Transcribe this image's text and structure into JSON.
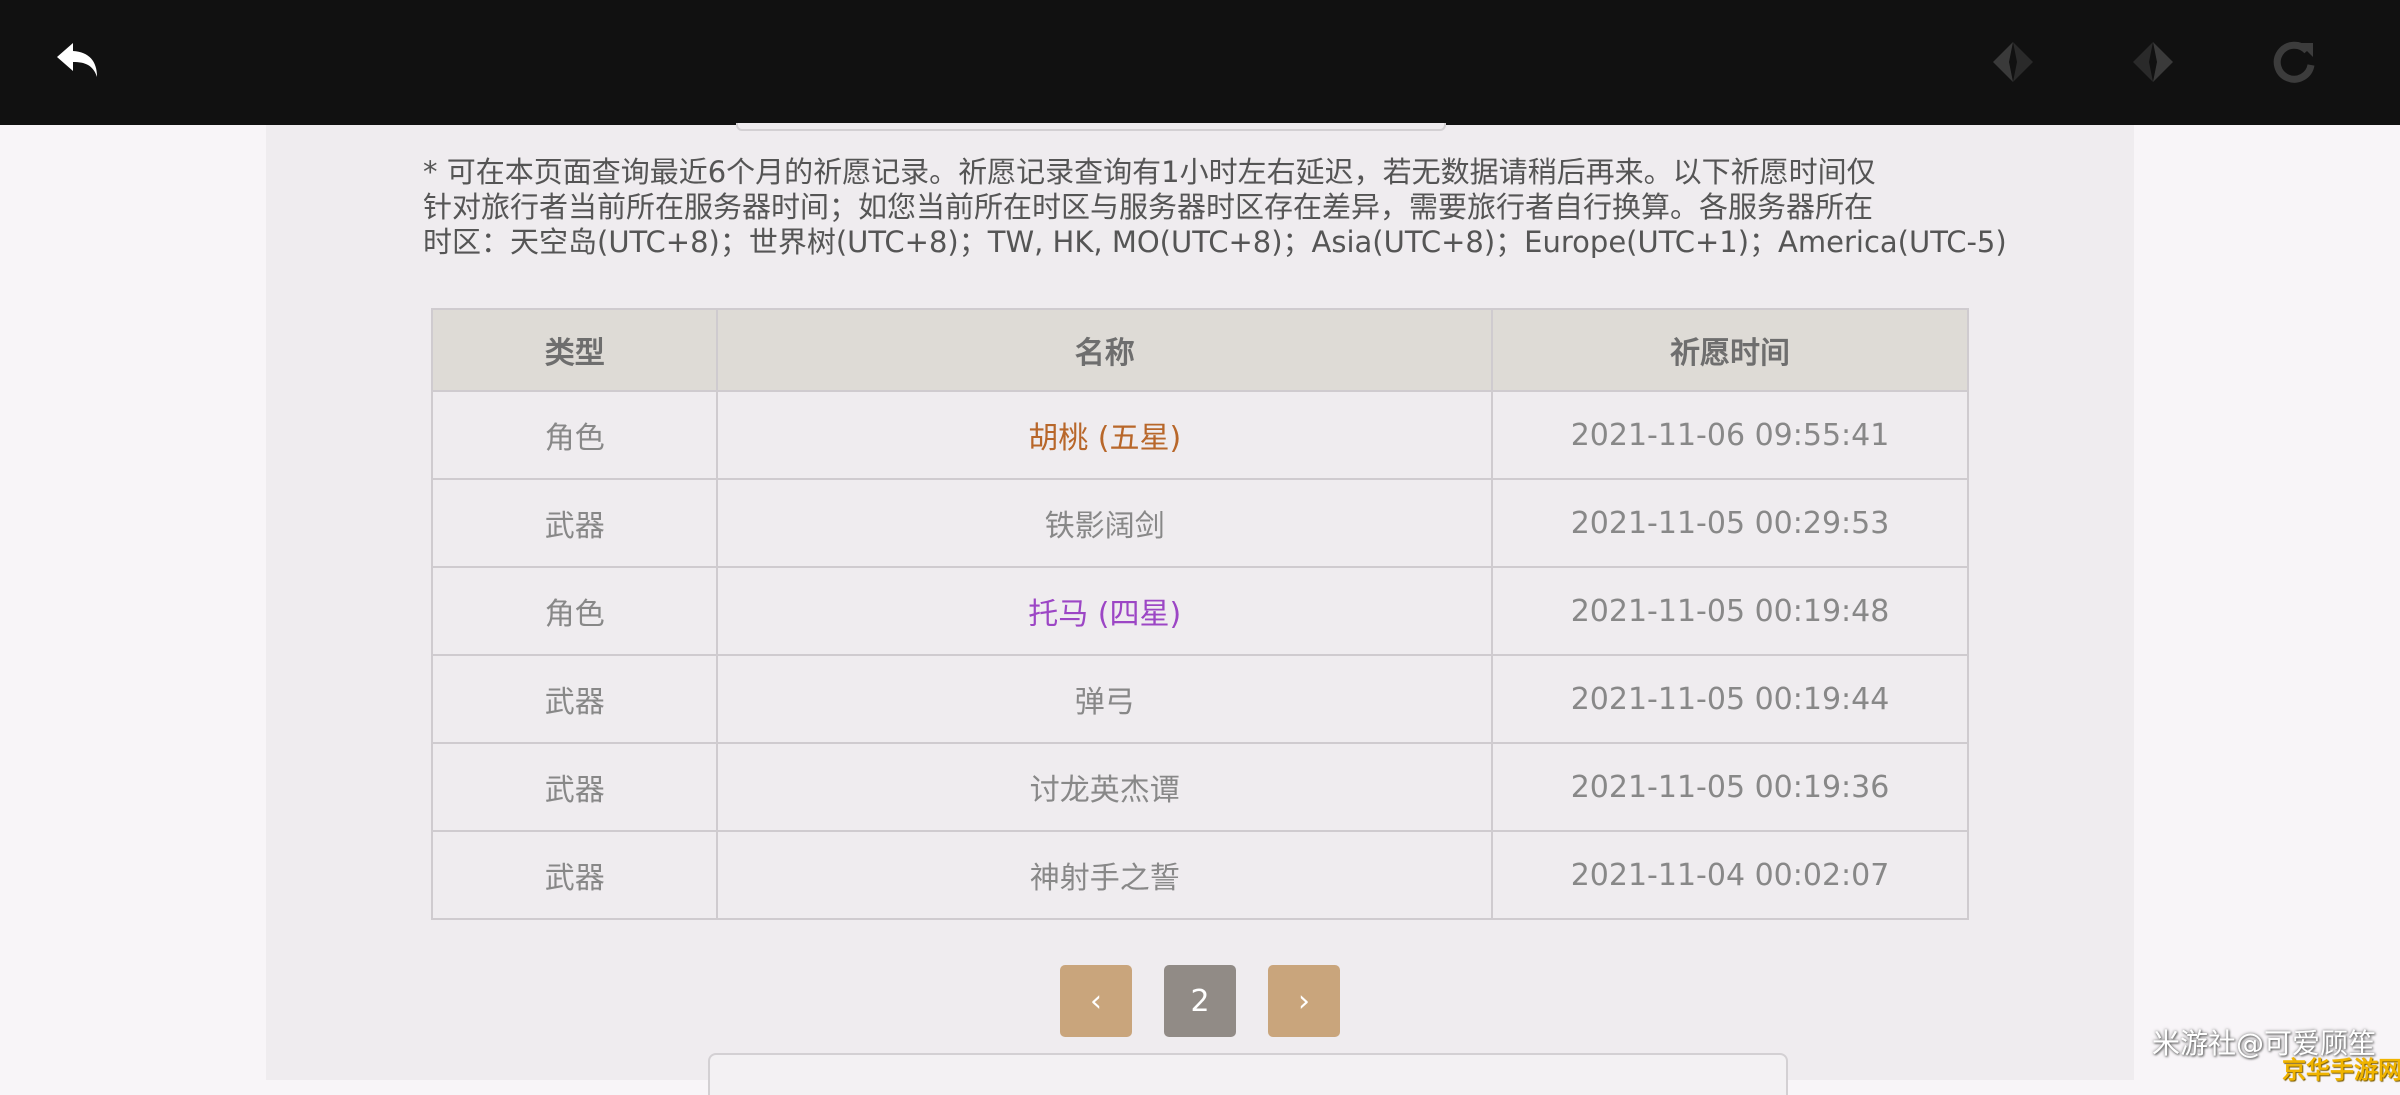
{
  "toolbar": {
    "back_icon": "back-arrow-icon",
    "prev_icon": "diamond-left-icon",
    "next_icon": "diamond-right-icon",
    "refresh_icon": "refresh-icon"
  },
  "notice": {
    "line1": "* 可在本页面查询最近6个月的祈愿记录。祈愿记录查询有1小时左右延迟，若无数据请稍后再来。以下祈愿时间仅",
    "line2": "针对旅行者当前所在服务器时间；如您当前所在时区与服务器时区存在差异，需要旅行者自行换算。各服务器所在",
    "line3": "时区：天空岛(UTC+8)；世界树(UTC+8)；TW, HK, MO(UTC+8)；Asia(UTC+8)；Europe(UTC+1)；America(UTC-5)"
  },
  "table": {
    "headers": [
      "类型",
      "名称",
      "祈愿时间"
    ],
    "rows": [
      {
        "type": "角色",
        "name": "胡桃 (五星)",
        "time": "2021-11-06 09:55:41",
        "rarity_color": "#b8672a"
      },
      {
        "type": "武器",
        "name": "铁影阔剑",
        "time": "2021-11-05 00:29:53",
        "rarity_color": "#888888"
      },
      {
        "type": "角色",
        "name": "托马 (四星)",
        "time": "2021-11-05 00:19:48",
        "rarity_color": "#9c46c5"
      },
      {
        "type": "武器",
        "name": "弹弓",
        "time": "2021-11-05 00:19:44",
        "rarity_color": "#888888"
      },
      {
        "type": "武器",
        "name": "讨龙英杰谭",
        "time": "2021-11-05 00:19:36",
        "rarity_color": "#888888"
      },
      {
        "type": "武器",
        "name": "神射手之誓",
        "time": "2021-11-04 00:02:07",
        "rarity_color": "#888888"
      }
    ]
  },
  "pager": {
    "prev_label": "‹",
    "current_page": "2",
    "next_label": "›",
    "nav_color": "#c9a57c",
    "current_color": "#918b86"
  },
  "watermark": {
    "text": "米游社@可爱顾笙",
    "logo": "京华手游网"
  }
}
